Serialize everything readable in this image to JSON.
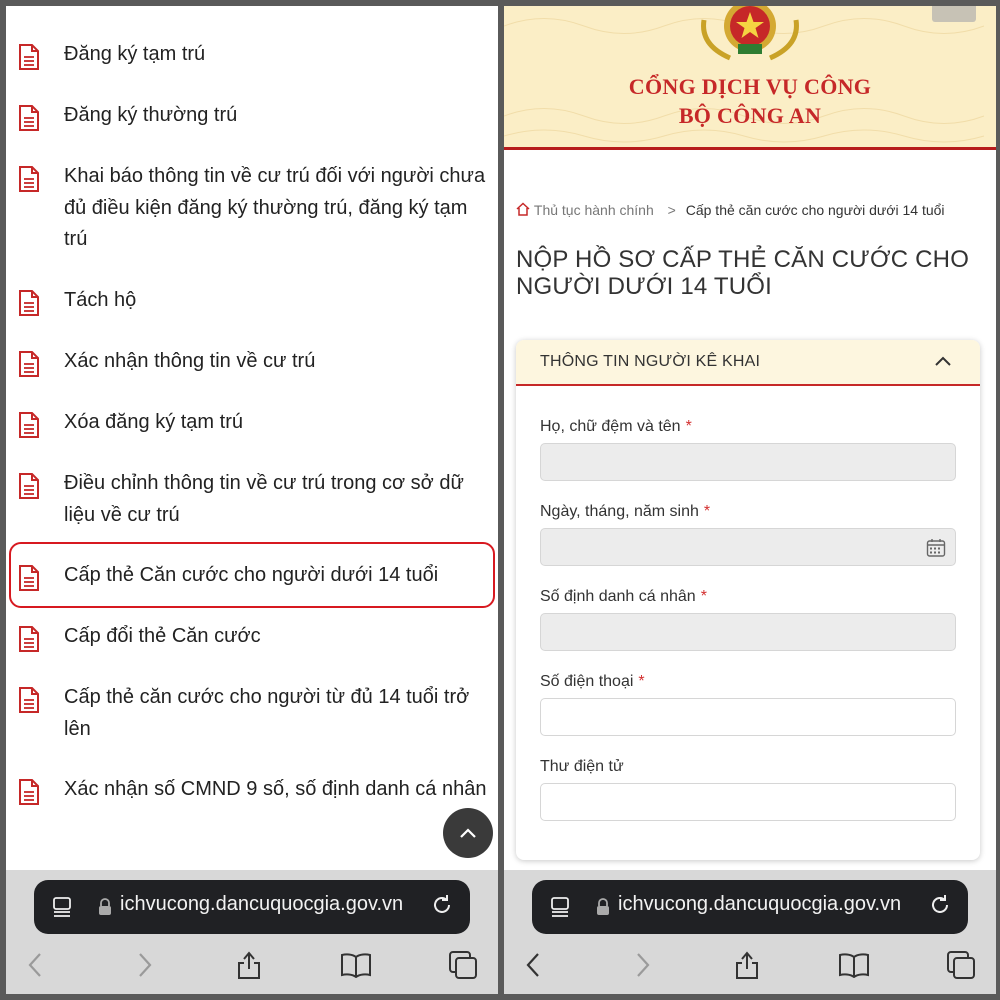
{
  "left": {
    "procedures": [
      {
        "label": "Đăng ký tạm trú"
      },
      {
        "label": "Đăng ký thường trú"
      },
      {
        "label": "Khai báo thông tin về cư trú đối với người chưa đủ điều kiện đăng ký thường trú, đăng ký tạm trú"
      },
      {
        "label": "Tách hộ"
      },
      {
        "label": "Xác nhận thông tin về cư trú"
      },
      {
        "label": "Xóa đăng ký tạm trú"
      },
      {
        "label": "Điều chỉnh thông tin về cư trú trong cơ sở dữ liệu về cư trú"
      },
      {
        "label": "Cấp thẻ Căn cước cho người dưới 14 tuổi",
        "highlighted": true
      },
      {
        "label": "Cấp đổi thẻ Căn cước"
      },
      {
        "label": "Cấp thẻ căn cước cho người từ đủ 14 tuổi trở lên"
      },
      {
        "label": "Xác nhận số CMND 9 số, số định danh cá nhân"
      }
    ],
    "browser": {
      "url": "ichvucong.dancuquocgia.gov.vn"
    }
  },
  "right": {
    "banner": {
      "line1": "CỔNG DỊCH VỤ CÔNG",
      "line2": "BỘ CÔNG AN"
    },
    "breadcrumb": {
      "home": "Thủ tục hành chính",
      "separator": ">",
      "current": "Cấp thẻ căn cước cho người dưới 14 tuổi"
    },
    "page_title": "NỘP HỒ SƠ CẤP THẺ CĂN CƯỚC CHO NGƯỜI DƯỚI 14 TUỔI",
    "section": {
      "title": "THÔNG TIN NGƯỜI KÊ KHAI"
    },
    "fields": [
      {
        "label": "Họ, chữ đệm và tên",
        "required": "*",
        "value": ""
      },
      {
        "label": "Ngày, tháng, năm sinh",
        "required": "*",
        "value": ""
      },
      {
        "label": "Số định danh cá nhân",
        "required": "*",
        "value": ""
      },
      {
        "label": "Số điện thoại",
        "required": "*",
        "value": ""
      },
      {
        "label": "Thư điện tử",
        "required": "",
        "value": ""
      }
    ],
    "browser": {
      "url": "ichvucong.dancuquocgia.gov.vn"
    }
  },
  "colors": {
    "accent_red": "#c62828",
    "banner_bg": "#fbeec6",
    "url_bar": "#202124"
  }
}
